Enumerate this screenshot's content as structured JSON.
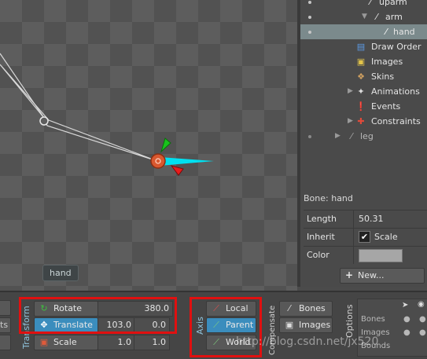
{
  "tree": {
    "items": [
      {
        "label": "uparm",
        "icon": "bone-icon"
      },
      {
        "label": "arm",
        "icon": "bone-icon"
      },
      {
        "label": "hand",
        "icon": "bone-icon",
        "selected": true
      },
      {
        "label": "Draw Order",
        "icon": "draw-order-icon"
      },
      {
        "label": "Images",
        "icon": "images-icon"
      },
      {
        "label": "Skins",
        "icon": "skins-icon"
      },
      {
        "label": "Animations",
        "icon": "animations-icon"
      },
      {
        "label": "Events",
        "icon": "events-icon"
      },
      {
        "label": "Constraints",
        "icon": "constraints-icon"
      },
      {
        "label": "leg",
        "icon": "bone-icon"
      }
    ]
  },
  "viewport": {
    "tooltip": "hand"
  },
  "properties": {
    "title": "Bone: hand",
    "length_label": "Length",
    "length_value": "50.31",
    "inherit_label": "Inherit",
    "scale_label": "Scale",
    "scale_checked": true,
    "color_label": "Color",
    "color_value": "#a6a6a6",
    "new_label": "New..."
  },
  "toolbar": {
    "transform_label": "Transform",
    "rotate_label": "Rotate",
    "rotate_value": "380.0",
    "translate_label": "Translate",
    "translate_x": "103.0",
    "translate_y": "0.0",
    "scale_label": "Scale",
    "scale_x": "1.0",
    "scale_y": "1.0",
    "axis_label": "Axis",
    "axis_local": "Local",
    "axis_parent": "Parent",
    "axis_world": "World",
    "axis_selected": "Parent",
    "compensate_label": "Compensate",
    "bones_label": "Bones",
    "images_label": "Images",
    "options_label": "Options",
    "options_rows": [
      "Bones",
      "Images",
      "Bounds"
    ],
    "watermark": "http://blog.csdn.net/jx520"
  },
  "colors": {
    "accent": "#3b8dbd",
    "highlight": "#e01010"
  }
}
